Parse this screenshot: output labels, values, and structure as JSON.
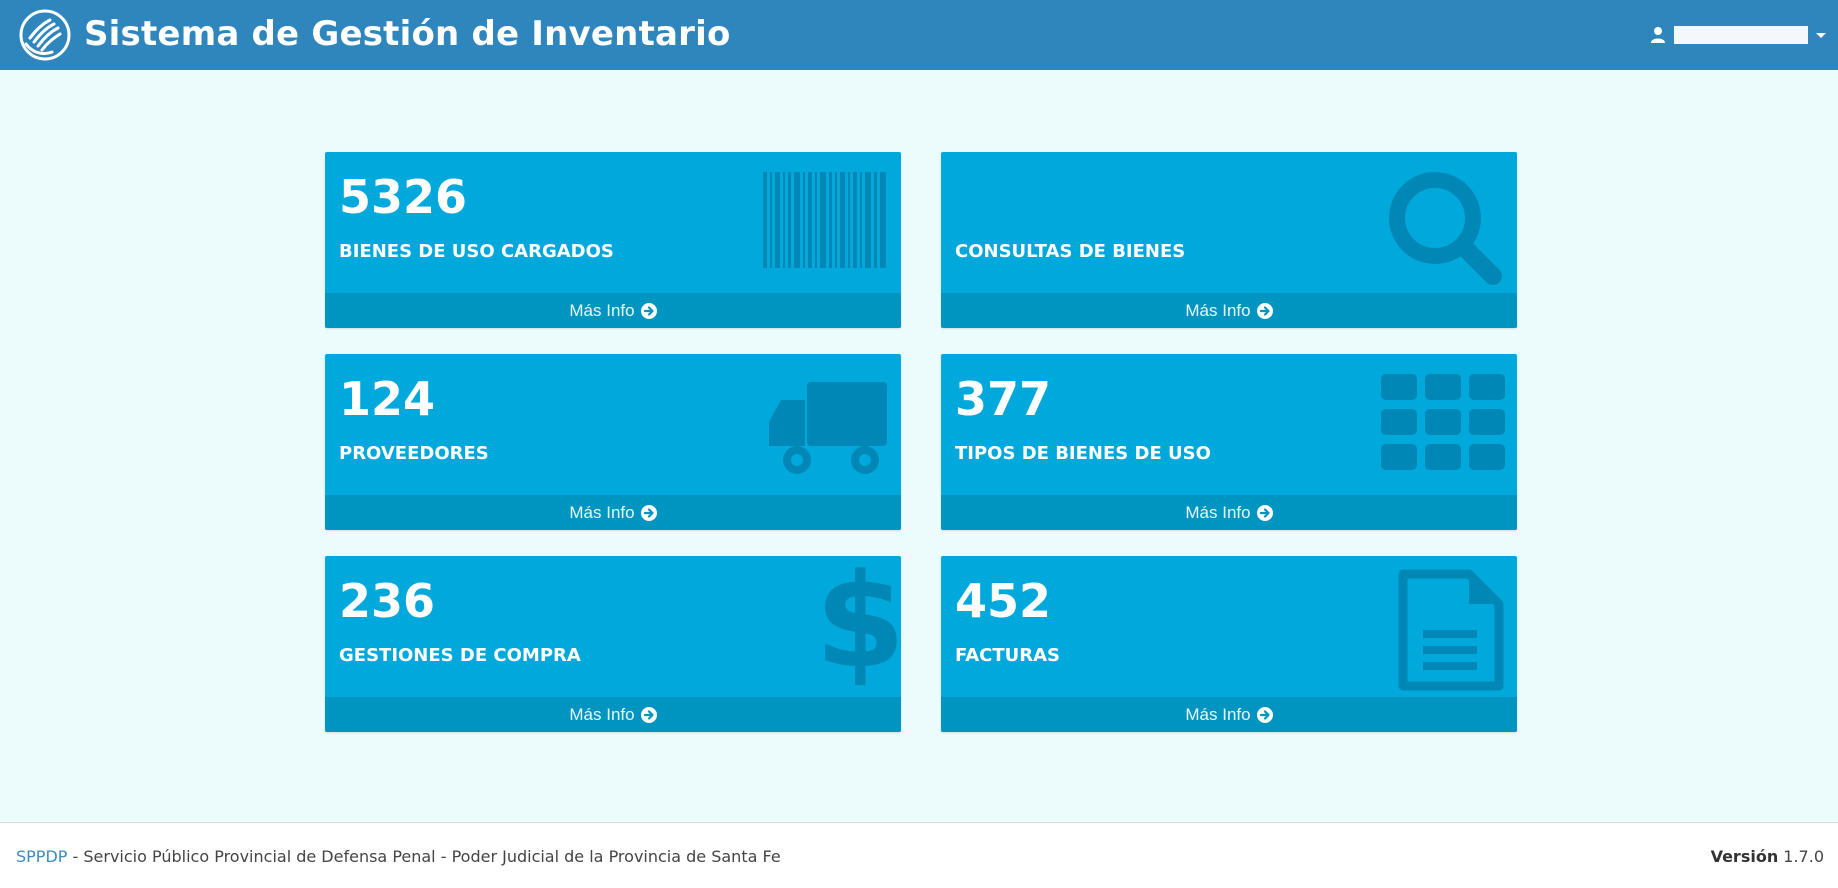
{
  "header": {
    "title": "Sistema de Gestión de Inventario",
    "user_name": "",
    "colors": {
      "bar": "#2e86bd"
    }
  },
  "cards": [
    {
      "value": "5326",
      "label": "BIENES DE USO CARGADOS",
      "icon": "barcode-icon",
      "footer": "Más Info"
    },
    {
      "value": "",
      "label": "CONSULTAS DE BIENES",
      "icon": "search-icon",
      "footer": "Más Info"
    },
    {
      "value": "124",
      "label": "PROVEEDORES",
      "icon": "truck-icon",
      "footer": "Más Info"
    },
    {
      "value": "377",
      "label": "TIPOS DE BIENES DE USO",
      "icon": "grid-icon",
      "footer": "Más Info"
    },
    {
      "value": "236",
      "label": "GESTIONES DE COMPRA",
      "icon": "dollar-icon",
      "footer": "Más Info"
    },
    {
      "value": "452",
      "label": "FACTURAS",
      "icon": "document-icon",
      "footer": "Más Info"
    }
  ],
  "footer": {
    "org_link": "SPPDP",
    "org_text": " - Servicio Público Provincial de Defensa Penal - Poder Judicial de la Provincia de Santa Fe",
    "version_label": "Versión",
    "version_value": " 1.7.0"
  },
  "colors": {
    "background": "#ecfcfd",
    "card": "#00a8dc",
    "card_footer": "#0095c1",
    "card_icon": "#0087b5"
  }
}
